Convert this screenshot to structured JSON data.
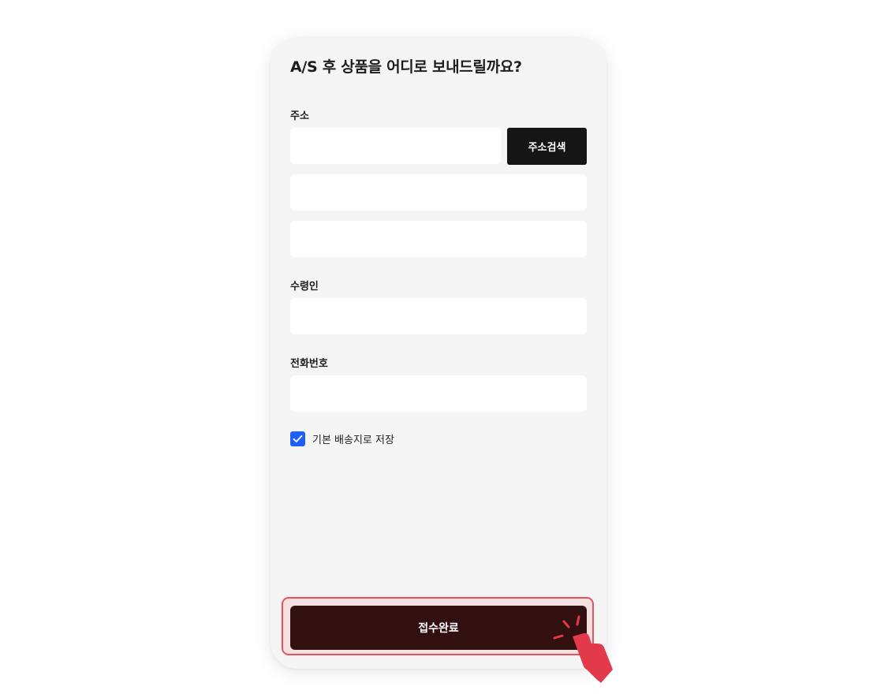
{
  "form": {
    "title": "A/S 후 상품을 어디로 보내드릴까요?",
    "address": {
      "label": "주소",
      "zip_value": "",
      "line1_value": "",
      "line2_value": "",
      "search_button_label": "주소검색"
    },
    "recipient": {
      "label": "수령인",
      "value": ""
    },
    "phone": {
      "label": "전화번호",
      "value": ""
    },
    "save_default": {
      "label": "기본 배송지로 저장",
      "checked": true
    },
    "submit_label": "접수완료"
  },
  "colors": {
    "checkbox": "#1f5ef8",
    "submit_button": "#321010",
    "search_button": "#151515",
    "highlight": "#e8525b",
    "cursor": "#e23a4a"
  },
  "icons": {
    "checkbox": "check-icon",
    "pointer": "hand-pointer-icon"
  }
}
